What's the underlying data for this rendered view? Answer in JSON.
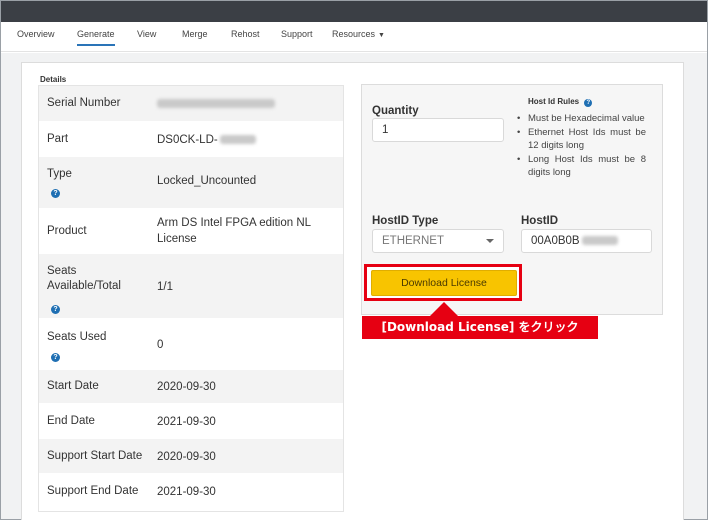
{
  "nav": {
    "items": [
      {
        "label": "Overview"
      },
      {
        "label": "Generate"
      },
      {
        "label": "View"
      },
      {
        "label": "Merge"
      },
      {
        "label": "Rehost"
      },
      {
        "label": "Support"
      },
      {
        "label": "Resources"
      }
    ],
    "active": "Generate"
  },
  "details": {
    "heading": "Details",
    "rows": [
      {
        "label": "Serial Number",
        "value": ""
      },
      {
        "label": "Part",
        "value": "DS0CK-LD-"
      },
      {
        "label": "Type",
        "value": "Locked_Uncounted"
      },
      {
        "label": "Product",
        "value": "Arm DS Intel FPGA edition NL License"
      },
      {
        "label": "Seats Available/Total",
        "value": "1/1"
      },
      {
        "label": "Seats Used",
        "value": "0"
      },
      {
        "label": "Start Date",
        "value": "2020-09-30"
      },
      {
        "label": "End Date",
        "value": "2021-09-30"
      },
      {
        "label": "Support Start Date",
        "value": "2020-09-30"
      },
      {
        "label": "Support End Date",
        "value": "2021-09-30"
      }
    ]
  },
  "form": {
    "quantity_label": "Quantity",
    "quantity_value": "1",
    "host_rules_title": "Host Id Rules",
    "host_rules": [
      "Must be Hexadecimal value",
      "Ethernet Host Ids must be 12 digits long",
      "Long Host Ids must be 8 digits long"
    ],
    "hostid_type_label": "HostID Type",
    "hostid_type_value": "ETHERNET",
    "hostid_label": "HostID",
    "hostid_value": "00A0B0B",
    "download_label": "Download License"
  },
  "callout": {
    "text": "[Download License] をクリック",
    "color": "#e60012"
  },
  "colors": {
    "accent": "#f8c400",
    "topbar": "#3b3f45",
    "active_tab": "#2a74b8"
  }
}
